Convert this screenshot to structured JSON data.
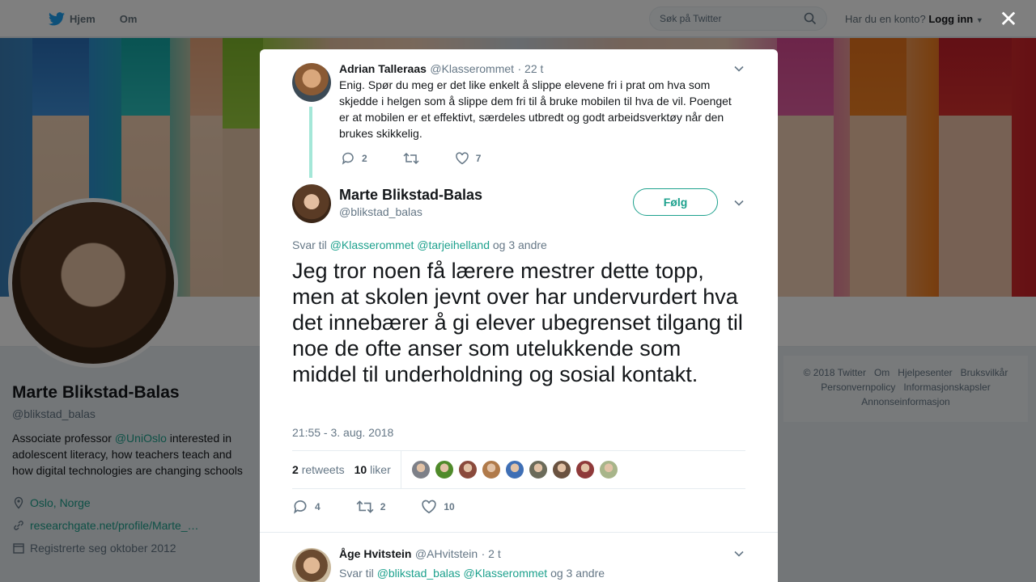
{
  "topnav": {
    "home": "Hjem",
    "about": "Om",
    "search_placeholder": "Søk på Twitter",
    "account_question": "Har du en konto?",
    "login": "Logg inn"
  },
  "profile": {
    "name": "Marte Blikstad-Balas",
    "handle": "@blikstad_balas",
    "bio_prefix": "Associate professor ",
    "bio_mention": "@UniOslo",
    "bio_suffix": " interested in adolescent literacy, how teachers teach and how digital technologies are changing schools",
    "location": "Oslo, Norge",
    "website": "researchgate.net/profile/Marte_…",
    "joined": "Registrerte seg oktober 2012"
  },
  "footer": {
    "copyright": "© 2018 Twitter",
    "about": "Om",
    "help": "Hjelpesenter",
    "terms": "Bruksvilkår",
    "privacy": "Personvernpolicy",
    "cookies": "Informasjonskapsler",
    "ads": "Annonseinformasjon"
  },
  "parent_tweet": {
    "name": "Adrian Talleraas",
    "handle": "@Klasserommet",
    "time": "· 22 t",
    "text": "Enig. Spør du meg er det like enkelt å slippe elevene fri i prat om hva som skjedde i helgen som å slippe dem fri til å bruke mobilen til hva de vil. Poenget er at mobilen er et effektivt, særdeles utbredt og godt arbeidsverktøy når den brukes skikkelig.",
    "replies": "2",
    "likes": "7"
  },
  "main_tweet": {
    "name": "Marte Blikstad-Balas",
    "handle": "@blikstad_balas",
    "follow": "Følg",
    "reply_prefix": "Svar til",
    "reply_to_1": "@Klasserommet",
    "reply_to_2": "@tarjeihelland",
    "reply_suffix": "og 3 andre",
    "text": "Jeg tror noen få lærere mestrer dette topp, men at skolen jevnt over har undervurdert hva det innebærer å gi elever ubegrenset tilgang til noe de ofte anser som utelukkende som middel til underholdning og sosial kontakt.",
    "timestamp": "21:55 - 3. aug. 2018",
    "retweets_count": "2",
    "retweets_label": "retweets",
    "likes_count": "10",
    "likes_label": "liker",
    "reply_count": "4",
    "retweet_action_count": "2",
    "like_action_count": "10",
    "liker_colors": [
      "#7d8088",
      "#4f8a2a",
      "#8a4a3c",
      "#b07a4a",
      "#3f6fb5",
      "#6b6b5a",
      "#6a5240",
      "#8f3a3a",
      "#a8b58a"
    ]
  },
  "next_tweet": {
    "name": "Åge Hvitstein",
    "handle": "@AHvitstein",
    "time": "· 2 t",
    "reply_prefix": "Svar til",
    "reply_to_1": "@blikstad_balas",
    "reply_to_2": "@Klasserommet",
    "reply_suffix": "og 3 andre"
  },
  "colors": {
    "accent": "#1da18d",
    "twitter_blue": "#1da1f2",
    "thread_line": "#a4e7d8"
  }
}
